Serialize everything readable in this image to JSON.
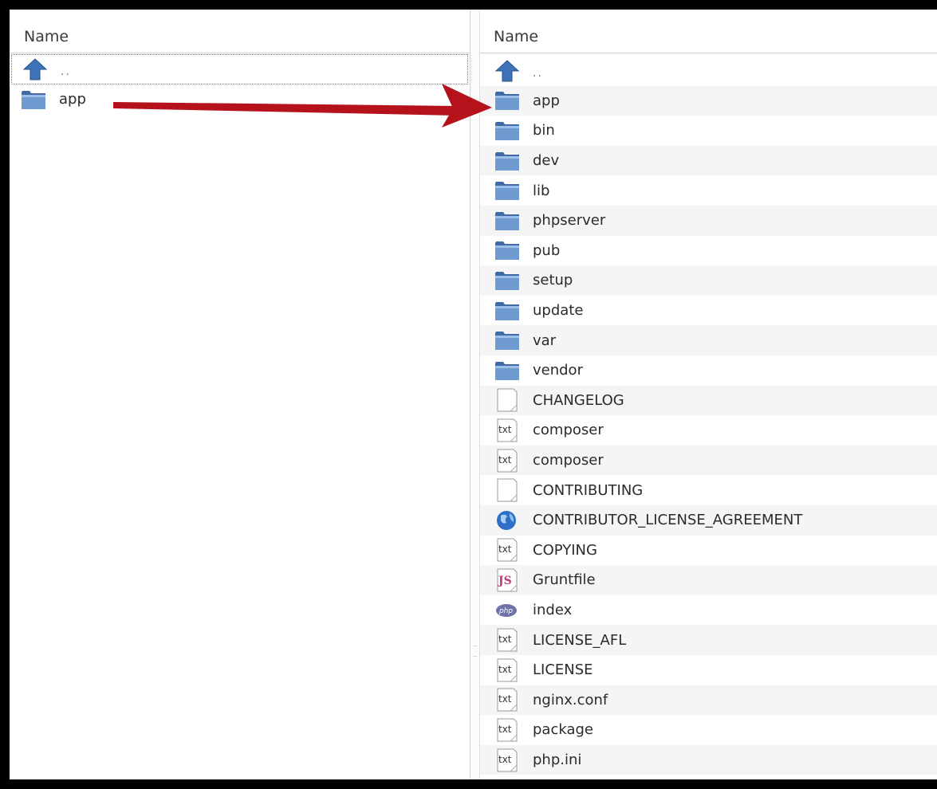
{
  "left_pane": {
    "header": "Name",
    "items": [
      {
        "label": "..",
        "icon": "parent-directory-icon"
      },
      {
        "label": "app",
        "icon": "folder-icon"
      }
    ]
  },
  "right_pane": {
    "header": "Name",
    "items": [
      {
        "label": "..",
        "icon": "parent-directory-icon"
      },
      {
        "label": "app",
        "icon": "folder-icon"
      },
      {
        "label": "bin",
        "icon": "folder-icon"
      },
      {
        "label": "dev",
        "icon": "folder-icon"
      },
      {
        "label": "lib",
        "icon": "folder-icon"
      },
      {
        "label": "phpserver",
        "icon": "folder-icon"
      },
      {
        "label": "pub",
        "icon": "folder-icon"
      },
      {
        "label": "setup",
        "icon": "folder-icon"
      },
      {
        "label": "update",
        "icon": "folder-icon"
      },
      {
        "label": "var",
        "icon": "folder-icon"
      },
      {
        "label": "vendor",
        "icon": "folder-icon"
      },
      {
        "label": "CHANGELOG",
        "icon": "blank-file-icon"
      },
      {
        "label": "composer",
        "icon": "text-file-icon"
      },
      {
        "label": "composer",
        "icon": "text-file-icon"
      },
      {
        "label": "CONTRIBUTING",
        "icon": "blank-file-icon"
      },
      {
        "label": "CONTRIBUTOR_LICENSE_AGREEMENT",
        "icon": "globe-html-icon"
      },
      {
        "label": "COPYING",
        "icon": "text-file-icon"
      },
      {
        "label": "Gruntfile",
        "icon": "javascript-file-icon"
      },
      {
        "label": "index",
        "icon": "php-file-icon"
      },
      {
        "label": "LICENSE_AFL",
        "icon": "text-file-icon"
      },
      {
        "label": "LICENSE",
        "icon": "text-file-icon"
      },
      {
        "label": "nginx.conf",
        "icon": "text-file-icon"
      },
      {
        "label": "package",
        "icon": "text-file-icon"
      },
      {
        "label": "php.ini",
        "icon": "text-file-icon"
      }
    ]
  },
  "icon_text": {
    "txt": "txt",
    "js": "JS",
    "php": "php"
  },
  "colors": {
    "folder": "#6f9bd0",
    "folder_dark": "#3f6aa6",
    "annotation_arrow": "#b5121b",
    "up_arrow": "#3d74b8",
    "row_stripe": "#f5f5f5"
  }
}
